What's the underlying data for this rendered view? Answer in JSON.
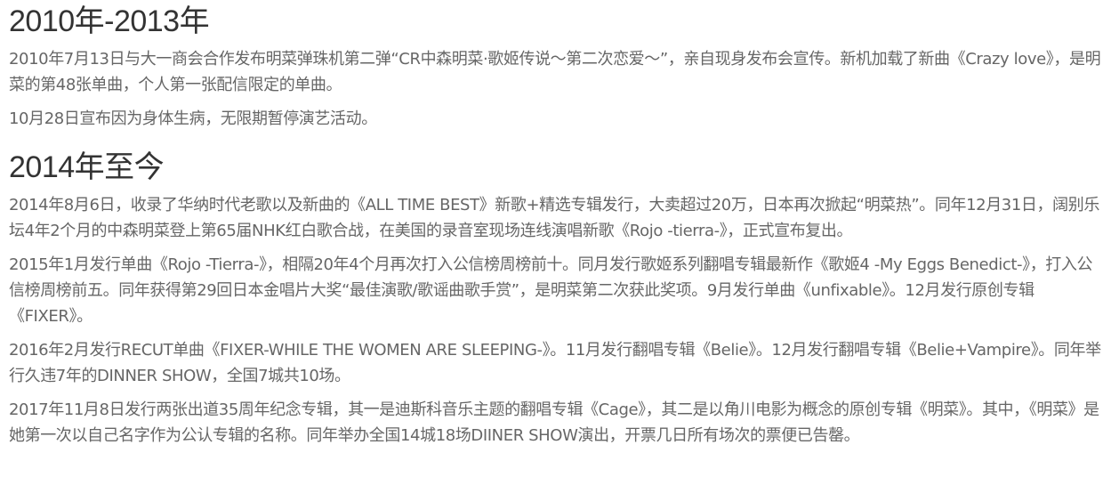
{
  "sections": [
    {
      "title": "2010年-2013年",
      "paragraphs": [
        "2010年7月13日与大一商会合作发布明菜弹珠机第二弹“CR中森明菜·歌姬传说～第二次恋爱～”，亲自现身发布会宣传。新机加载了新曲《Crazy love》，是明菜的第48张单曲，个人第一张配信限定的单曲。",
        "10月28日宣布因为身体生病，无限期暂停演艺活动。"
      ]
    },
    {
      "title": "2014年至今",
      "paragraphs": [
        "2014年8月6日，收录了华纳时代老歌以及新曲的《ALL TIME BEST》新歌+精选专辑发行，大卖超过20万，日本再次掀起“明菜热”。同年12月31日，阔别乐坛4年2个月的中森明菜登上第65届NHK红白歌合战，在美国的录音室现场连线演唱新歌《Rojo -tierra-》，正式宣布复出。",
        "2015年1月发行单曲《Rojo -Tierra-》，相隔20年4个月再次打入公信榜周榜前十。同月发行歌姬系列翻唱专辑最新作《歌姬4 -My Eggs Benedict-》，打入公信榜周榜前五。同年获得第29回日本金唱片大奖“最佳演歌/歌谣曲歌手赏”，是明菜第二次获此奖项。9月发行单曲《unfixable》。12月发行原创专辑《FIXER》。",
        "2016年2月发行RECUT单曲《FIXER-WHILE THE WOMEN ARE SLEEPING-》。11月发行翻唱专辑《Belie》。12月发行翻唱专辑《Belie+Vampire》。同年举行久违7年的DINNER SHOW，全国7城共10场。",
        "2017年11月8日发行两张出道35周年纪念专辑，其一是迪斯科音乐主题的翻唱专辑《Cage》，其二是以角川电影为概念的原创专辑《明菜》。其中，《明菜》是她第一次以自己名字作为公认专辑的名称。同年举办全国14城18场DIINER SHOW演出，开票几日所有场次的票便已告罄。"
      ]
    }
  ]
}
